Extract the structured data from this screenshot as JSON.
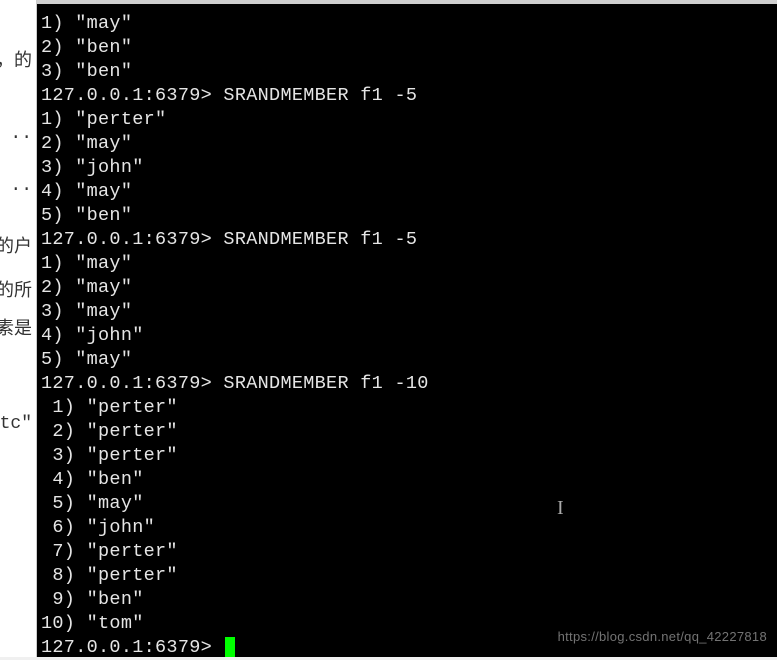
{
  "left_panel": {
    "items": [
      "的，",
      "..",
      "..",
      "的户",
      "的所",
      "素是",
      "\"tc"
    ]
  },
  "terminal": {
    "lines": [
      "1) \"may\"",
      "2) \"ben\"",
      "3) \"ben\"",
      "127.0.0.1:6379> SRANDMEMBER f1 -5",
      "1) \"perter\"",
      "2) \"may\"",
      "3) \"john\"",
      "4) \"may\"",
      "5) \"ben\"",
      "127.0.0.1:6379> SRANDMEMBER f1 -5",
      "1) \"may\"",
      "2) \"may\"",
      "3) \"may\"",
      "4) \"john\"",
      "5) \"may\"",
      "127.0.0.1:6379> SRANDMEMBER f1 -10",
      " 1) \"perter\"",
      " 2) \"perter\"",
      " 3) \"perter\"",
      " 4) \"ben\"",
      " 5) \"may\"",
      " 6) \"john\"",
      " 7) \"perter\"",
      " 8) \"perter\"",
      " 9) \"ben\"",
      "10) \"tom\""
    ],
    "prompt": "127.0.0.1:6379> "
  },
  "watermark": "https://blog.csdn.net/qq_42227818"
}
